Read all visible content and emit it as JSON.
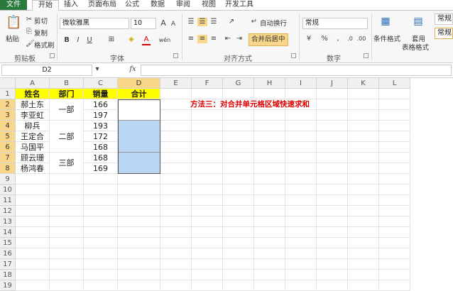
{
  "tabs": [
    "文件",
    "开始",
    "插入",
    "页面布局",
    "公式",
    "数据",
    "审阅",
    "视图",
    "开发工具"
  ],
  "clipboard": {
    "paste": "粘贴",
    "cut": "剪切",
    "copy": "复制",
    "format_painter": "格式刷",
    "group": "剪贴板"
  },
  "font": {
    "name": "微软雅黑",
    "size": "10",
    "bold": "B",
    "italic": "I",
    "underline": "U",
    "grow": "A",
    "shrink": "A",
    "color_a": "A",
    "wen": "wén",
    "group": "字体"
  },
  "alignment": {
    "wrap": "自动换行",
    "merge": "合并后居中",
    "group": "对齐方式"
  },
  "number": {
    "format": "常规",
    "group": "数字"
  },
  "styles": {
    "cond": "条件格式",
    "table1": "套用",
    "table2": "表格格式",
    "style_box": "常规",
    "style_box2": "常规"
  },
  "formula_bar": {
    "name_box": "D2",
    "fx": "fx",
    "content": ""
  },
  "columns": [
    "A",
    "B",
    "C",
    "D",
    "E",
    "F",
    "G",
    "H",
    "I",
    "J",
    "K",
    "L"
  ],
  "rows": [
    "1",
    "2",
    "3",
    "4",
    "5",
    "6",
    "7",
    "8",
    "9",
    "10",
    "11",
    "12",
    "13",
    "14",
    "15",
    "16",
    "17",
    "18",
    "19"
  ],
  "table": {
    "headers": [
      "姓名",
      "部门",
      "销量",
      "合计"
    ],
    "names": [
      "郝土东",
      "李亚虹",
      "柳兵",
      "王定合",
      "马国平",
      "顾云珊",
      "杨鸿春"
    ],
    "depts": [
      "一部",
      "二部",
      "三部"
    ],
    "sales": [
      "166",
      "197",
      "193",
      "172",
      "168",
      "168",
      "169"
    ]
  },
  "note": "方法三：对合并单元格区域快速求和",
  "colors": {
    "header_fill": "#ffff00",
    "selection_fill": "#b9d6f5",
    "note_color": "#e00000",
    "file_tab": "#2b7a3d"
  }
}
